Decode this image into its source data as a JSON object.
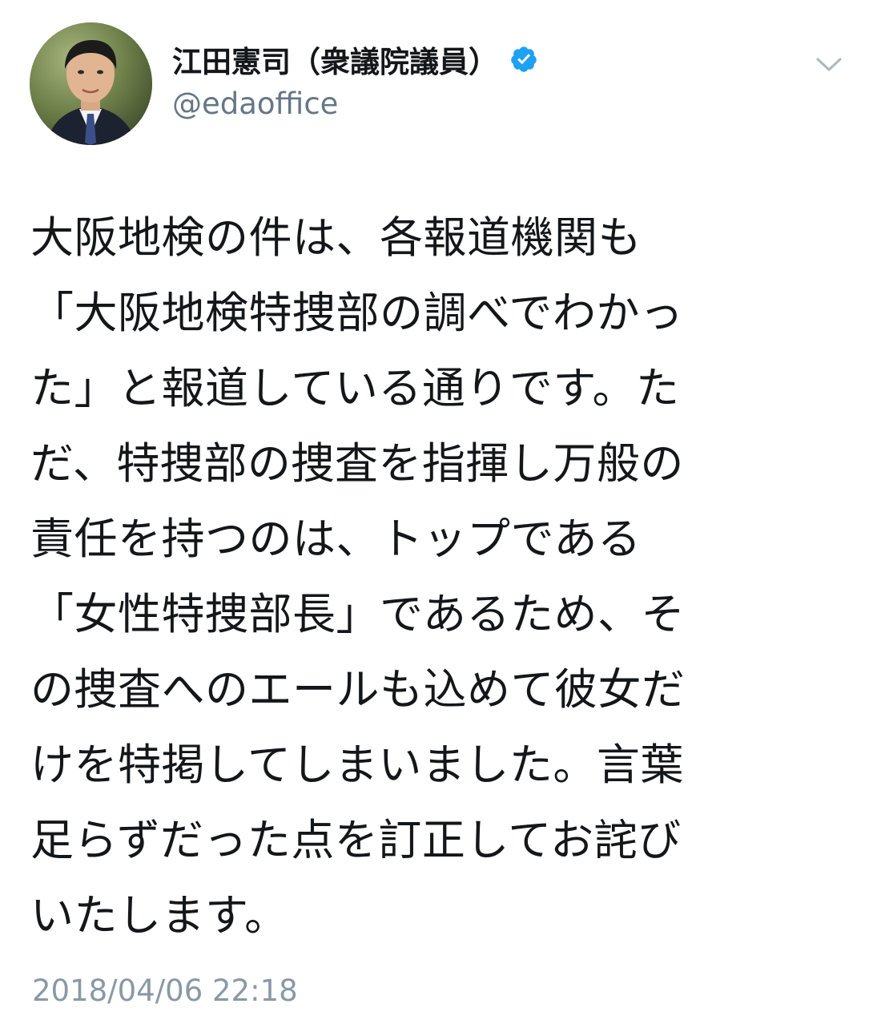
{
  "author": {
    "display_name": "江田憲司（衆議院議員）",
    "handle": "@edaoffice",
    "verified": true,
    "avatar_icon": "profile-photo",
    "verified_color": "#1da1f2"
  },
  "menu_icon": "chevron-down-icon",
  "tweet": {
    "lines": [
      "大阪地検の件は、各報道機関も",
      "「大阪地検特捜部の調べでわかっ",
      "た」と報道している通りです。た",
      "だ、特捜部の捜査を指揮し万般の",
      "責任を持つのは、トップである",
      "「女性特捜部長」であるため、そ",
      "の捜査へのエールも込めて彼女だ",
      "けを特掲してしまいました。言葉",
      "足らずだった点を訂正してお詫び",
      "いたします。"
    ],
    "timestamp": "2018/04/06 22:18"
  },
  "colors": {
    "text": "#14171a",
    "secondary": "#657786",
    "timestamp": "#8899a6"
  }
}
